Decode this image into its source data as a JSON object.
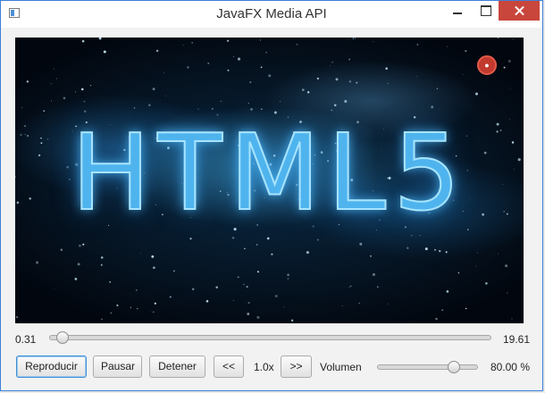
{
  "window": {
    "title": "JavaFX Media API",
    "icons": {
      "app": "app-window-icon",
      "minimize": "minimize-icon",
      "maximize": "maximize-icon",
      "close": "close-icon"
    }
  },
  "video": {
    "logo_text": "HTML5",
    "watermark_icon": "channel-logo-icon"
  },
  "seek": {
    "current": "0.31",
    "total": "19.61",
    "progress": 0.0158
  },
  "controls": {
    "play": "Reproducir",
    "pause": "Pausar",
    "stop": "Detener",
    "back": "<<",
    "speed": "1.0x",
    "forward": ">>",
    "volume_label": "Volumen",
    "volume_value": 0.8,
    "volume_text": "80.00 %"
  },
  "colors": {
    "accent": "#3d7fd6",
    "close": "#c9463d",
    "focus": "#3f8ed3"
  }
}
